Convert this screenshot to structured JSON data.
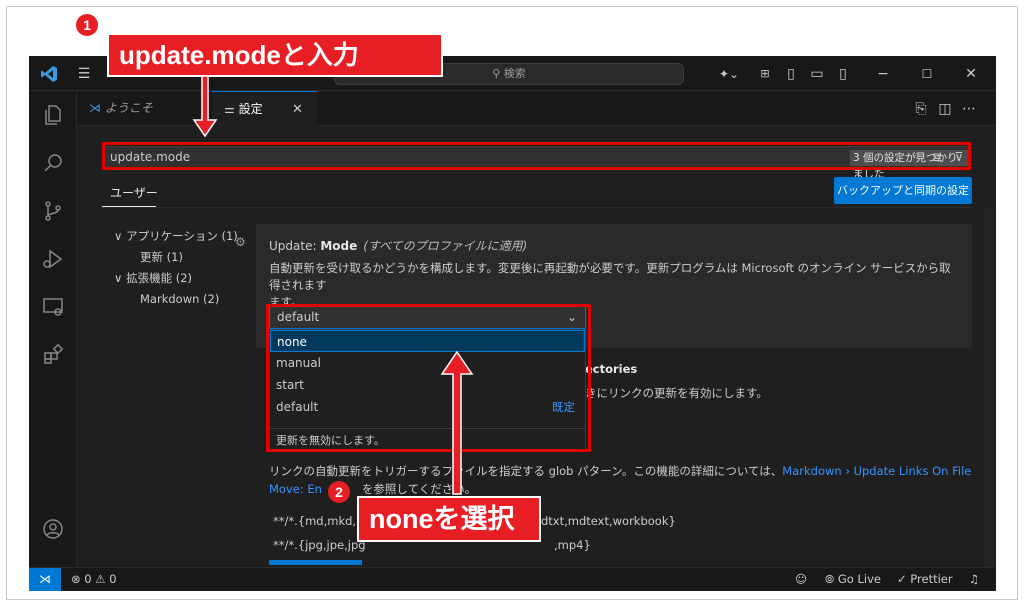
{
  "window": {
    "search_placeholder": "検索"
  },
  "tabs": [
    {
      "label": "ようこそ"
    },
    {
      "label": "設定"
    }
  ],
  "settings": {
    "search_value": "update.mode",
    "result_count": "3 個の設定が見つかりました",
    "scope_tab": "ユーザー",
    "sync_button": "バックアップと同期の設定",
    "toc": [
      "∨ アプリケーション (1)",
      "更新 (1)",
      "∨ 拡張機能 (2)",
      "Markdown (2)"
    ],
    "update_mode": {
      "title_prefix": "Update: ",
      "title_name": "Mode",
      "scope_note": "(すべてのプロファイルに適用)",
      "description_line1": "自動更新を受け取るかどうかを構成します。変更後に再起動が必要です。更新プログラムは Microsoft のオンライン サービスから取得されます",
      "description_line2": "ます。",
      "current_value": "default",
      "options": [
        "none",
        "manual",
        "start",
        "default"
      ],
      "default_marker": "既定",
      "selected_option_description": "更新を無効にします。"
    },
    "background": {
      "heading_fragment": "ectories",
      "desc_fragment": "きにリンクの更新を有効にします。",
      "glob_desc_prefix": "リンクの自動更新をトリガーするファイルを指定する glob パターン。この機能の詳細については、",
      "glob_link": "Markdown › Update Links On File",
      "glob_link2": "Move: En",
      "glob_desc_suffix": "を参照してください。",
      "pattern1_left": "**/*.{md,mkd,r",
      "pattern1_right": "dtxt,mdtext,workbook}",
      "pattern2": "**/*.{jpg,jpe,jpg",
      "pattern2_right": ",mp4}"
    }
  },
  "statusbar": {
    "errors": "0",
    "warnings": "0",
    "go_live": "Go Live",
    "prettier": "Prettier"
  },
  "annotations": {
    "step1_number": "1",
    "step1_label": "update.modeと入力",
    "step2_number": "2",
    "step2_label": "noneを選択"
  },
  "colors": {
    "accent": "#0078d4",
    "annotation_red": "#e81e25"
  }
}
